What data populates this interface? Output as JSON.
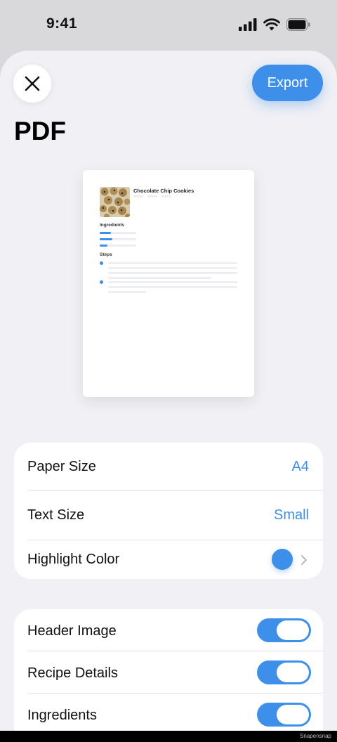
{
  "status_bar": {
    "time": "9:41"
  },
  "header": {
    "export_label": "Export",
    "title": "PDF"
  },
  "preview": {
    "recipe_title": "Chocolate Chip Cookies",
    "ingredients_label": "Ingredients",
    "steps_label": "Steps",
    "ingredient_progress": [
      0.3,
      0.35,
      0.22
    ]
  },
  "format_settings": {
    "paper_size": {
      "label": "Paper Size",
      "value": "A4"
    },
    "text_size": {
      "label": "Text Size",
      "value": "Small"
    },
    "highlight_color": {
      "label": "Highlight Color",
      "value": "#3e8fea"
    }
  },
  "content_settings": {
    "header_image": {
      "label": "Header Image",
      "on": true
    },
    "recipe_details": {
      "label": "Recipe Details",
      "on": true
    },
    "ingredients": {
      "label": "Ingredients",
      "on": true
    }
  },
  "colors": {
    "accent": "#3e8fea",
    "background": "#f0f0f5"
  },
  "watermark": "Snapensnap"
}
